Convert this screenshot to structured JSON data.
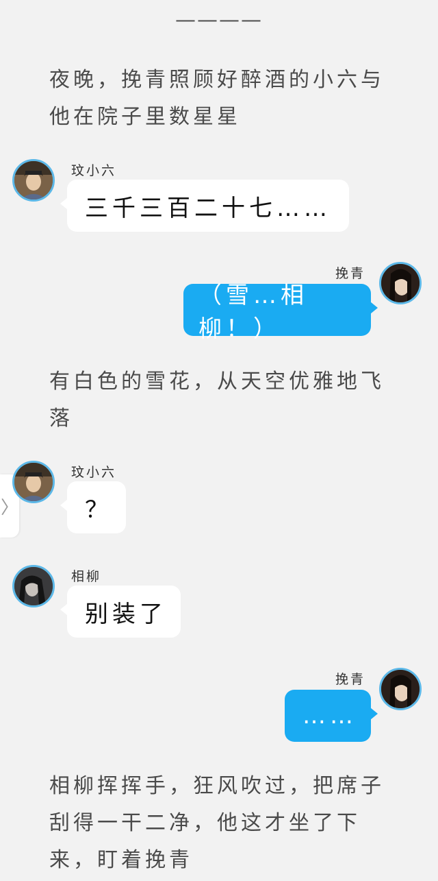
{
  "divider": "————",
  "narrations": [
    "夜晚，挽青照顾好醉酒的小六与他在院子里数星星",
    "有白色的雪花，从天空优雅地飞落",
    "相柳挥挥手，狂风吹过，把席子刮得一干二净，他这才坐了下来，盯着挽青"
  ],
  "messages": [
    {
      "sender": "玟小六",
      "text": "三千三百二十七……",
      "side": "left",
      "avatar": "woman-hat-avatar"
    },
    {
      "sender": "挽青",
      "text": "（雪…相柳！）",
      "side": "right",
      "avatar": "dark-hair-girl-avatar"
    },
    {
      "sender": "玟小六",
      "text": "？",
      "side": "left",
      "avatar": "woman-hat-avatar"
    },
    {
      "sender": "相柳",
      "text": "别装了",
      "side": "left",
      "avatar": "dark-man-avatar"
    },
    {
      "sender": "挽青",
      "text": "……",
      "side": "right",
      "avatar": "dark-hair-girl-avatar"
    }
  ],
  "side_tab": {
    "icon": "chevron-right-icon",
    "glyph": "〉"
  },
  "colors": {
    "background": "#f2f2f2",
    "right_bubble": "#1aabf2",
    "left_bubble": "#ffffff",
    "avatar_ring": "#5cb8e8"
  }
}
